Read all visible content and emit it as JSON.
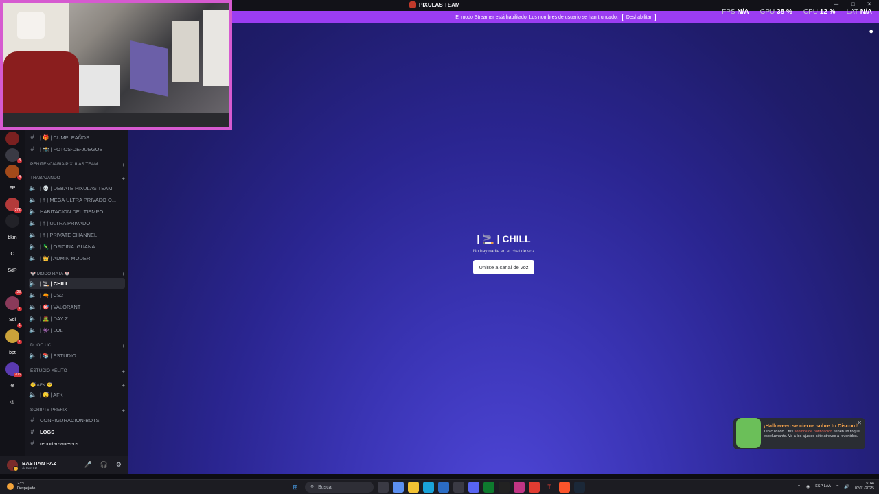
{
  "window": {
    "title": "PIXULAS TEAM",
    "controls": [
      "─",
      "□",
      "✕"
    ]
  },
  "perf": {
    "fps_label": "FPS",
    "fps_value": "N/A",
    "gpu_label": "GPU",
    "gpu_value": "38 %",
    "cpu_label": "CPU",
    "cpu_value": "12 %",
    "lat_label": "LAT",
    "lat_value": "N/A"
  },
  "banner": {
    "text": "El modo Streamer está habilitado. Los nombres de usuario se han truncado.",
    "button": "Deshabilitar"
  },
  "rail": {
    "items": [
      {
        "label": "",
        "color": "#7a2020",
        "badge": ""
      },
      {
        "label": "",
        "color": "#3a3a44",
        "badge": "8"
      },
      {
        "label": "",
        "color": "#a34a1a",
        "badge": "4"
      },
      {
        "label": "FP",
        "color": "#121218",
        "badge": ""
      },
      {
        "label": "",
        "color": "#b33a3a",
        "badge": "372"
      },
      {
        "label": "",
        "color": "#222228",
        "badge": ""
      },
      {
        "label": "bkm",
        "color": "#121218",
        "badge": ""
      },
      {
        "label": "C",
        "color": "#121218",
        "badge": ""
      },
      {
        "label": "SdP",
        "color": "#121218",
        "badge": ""
      },
      {
        "label": "",
        "color": "#121218",
        "badge": "23"
      },
      {
        "label": "",
        "color": "#8a3a5a",
        "badge": "1"
      },
      {
        "label": "Sdl",
        "color": "#121218",
        "badge": "1"
      },
      {
        "label": "",
        "color": "#caa23a",
        "badge": "1"
      },
      {
        "label": "bpt",
        "color": "#121218",
        "badge": ""
      },
      {
        "label": "",
        "color": "#5a3ab0",
        "badge": "206"
      },
      {
        "label": "⊕",
        "color": "#121218",
        "badge": ""
      },
      {
        "label": "◎",
        "color": "#121218",
        "badge": ""
      }
    ]
  },
  "channels": {
    "cumpleanos": "| 🎁 | CUMPLEAÑOS",
    "fotos": "| 📸 | FOTOS-DE-JUEGOS",
    "cat_penitenciaria": "PENITENCIARIA PIXULAS TEAM...",
    "cat_trabajando": "TRABAJANDO",
    "debate": "| 💀 | DEBATE PIXULAS TEAM",
    "mega": "| † | MEGA ULTRA PRIVADO O...",
    "habitacion": "HABITACION DEL TIEMPO",
    "ultra": "| † | ULTRA PRIVADO",
    "private": "| † | PRIVATE CHANNEL",
    "oficina": "| 🦎 | OFICINA IGUANA",
    "admin": "| 👑 | ADMIN MODER",
    "cat_rata": "🐭 MODO RATA 🐭",
    "chill": "| 🚬 | CHILL",
    "cs2": "| 🔫 | CS2",
    "valorant": "| 🎯 | VALORANT",
    "dayz": "| 🧟 | DAY Z",
    "lol": "| 👾 | LOL",
    "cat_duoc": "DUOC UC",
    "estudio": "| 📚 | ESTUDIO",
    "cat_xelito": "ESTUDIO XELITO",
    "cat_afk": "😴 AFK 😴",
    "afk": "| 😴 | AFK",
    "cat_scripts": "SCRIPTS PREFIX",
    "config": "CONFIGURACION-BOTS",
    "logs": "LOGS",
    "reportar": "reportar-wnes-cs"
  },
  "user": {
    "name": "BASTIAN PAZ",
    "status": "Ausente"
  },
  "stage": {
    "title": "| 🚬 | CHILL",
    "subtitle": "No hay nadie en el chat de voz",
    "join": "Unirse a canal de voz"
  },
  "toast": {
    "title": "¡Halloween se cierne sobre tu Discord!",
    "body_start": "Ten cuidado... tus ",
    "body_link": "sonidos de notificación",
    "body_end": " tienen un toque espeluznante. Ve a los ajustes si te atreves a revertirlos."
  },
  "taskbar": {
    "weather_temp": "23°C",
    "weather_desc": "Despejado",
    "search": "Buscar",
    "lang": "ESP LAA",
    "time": "5:14",
    "date": "02/11/2025"
  },
  "colors": {
    "accent": "#9b3df2",
    "webcam_border": "#d65ad0",
    "stage_bg": "#2a2590"
  }
}
